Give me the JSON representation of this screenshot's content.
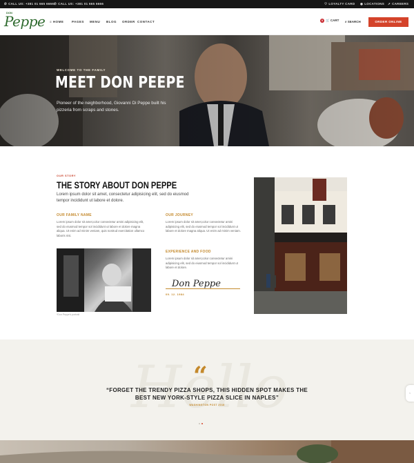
{
  "topbar": {
    "call1": "CALL US: +381 01 665 6666",
    "call2": "CALL US: +381 01 665 6666",
    "loyalty": "LOYALTY CARD",
    "locations": "LOCATIONS",
    "careers": "CAREERS"
  },
  "nav": {
    "logo": "Peppe",
    "logo_small": "DON",
    "items": [
      "HOME",
      "PAGES",
      "MENU",
      "BLOG",
      "ORDER",
      "CONTACT"
    ],
    "cart_count": "0",
    "cart": "CART",
    "search": "SEARCH",
    "order_button": "ORDER ONLINE"
  },
  "hero": {
    "kicker": "WELCOME TO THE FAMILY",
    "title": "MEET DON PEEPE",
    "description": "Pioneer of the neighborhood, Giovanni Di Peppe built his pizzeria from scraps and stones."
  },
  "story": {
    "kicker": "OUR STORY",
    "title": "THE STORY  ABOUT DON PEPPE",
    "lead": "Lorem ipsum dolor sit amet, consectetur adipisicing elit, sed do eiusmod tempor incididunt ut labore et dolore.",
    "family_title": "OUR FAMILY NAME",
    "family_body": "Lorem ipsum dolor sit amet,colur consectetur amini adipisicing elit, sed do eiusmod tempor sol incididunt ut labore et dolore magna aliqua. Ut enim ad minim veniam, quis nostrud exercitation ullamco laboris nisi.",
    "journey_title": "OUR JOURNEY",
    "journey_body": "Lorem ipsum dolor sit amet,colur consectetur amini adipisicing elit, sed do eiusmod tempor sol incididunt ut labore et dolore magna aliqua. Ut enim ad minim veniam.",
    "experience_title": "EXPERIENCE AND FOOD",
    "experience_body": "Lorem ipsum dolor sit amet,colur consectetur amini adipisicing elit, sed do eiusmod tempor sol incididunt ut labore et dolore.",
    "signature": "Don Peppe",
    "date": "09. 12. 1984",
    "caption": "*Don Peppe's portrait"
  },
  "quote": {
    "background_word": "Hello",
    "mark": "“",
    "text": "“FORGET THE TRENDY PIZZA SHOPS, THIS HIDDEN SPOT MAKES THE BEST NEW YORK-STYLE PIZZA SLICE IN NAPLES”",
    "source": "WASHINGTON POST 2016"
  },
  "colors": {
    "accent": "#d4432a",
    "gold": "#c4892c",
    "green": "#2e6a2e"
  }
}
